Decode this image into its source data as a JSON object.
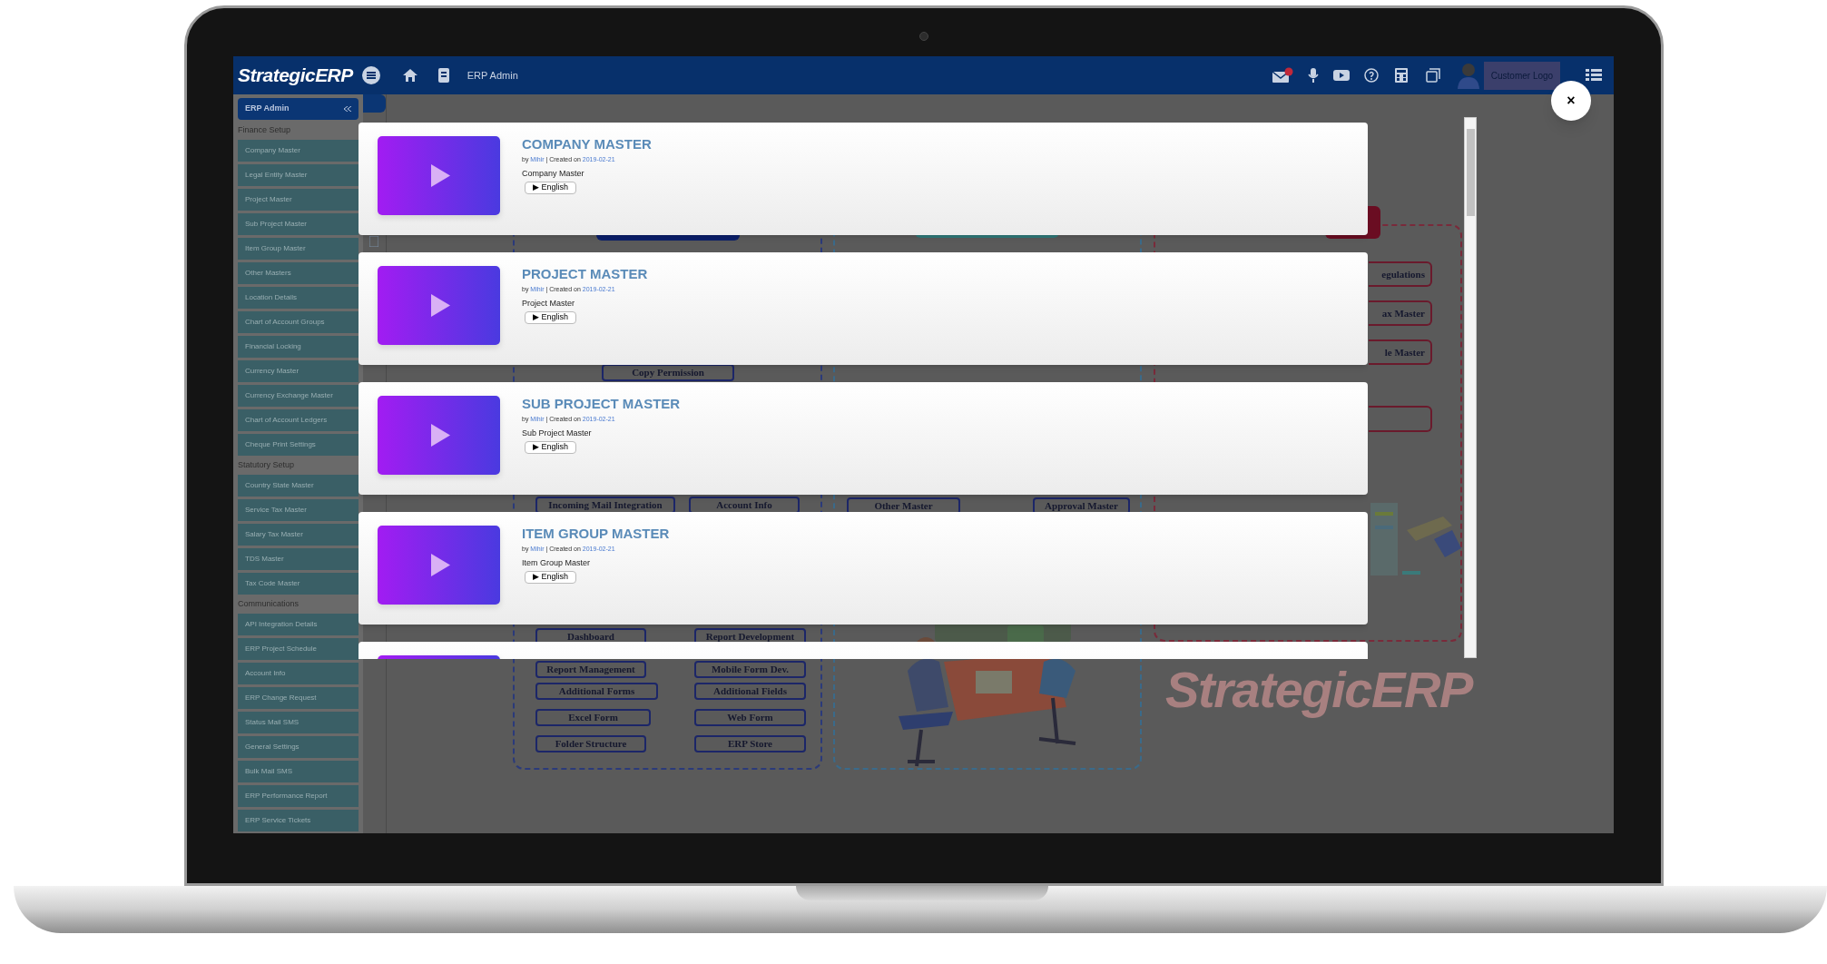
{
  "topbar": {
    "logo": "StrategicERP",
    "breadcrumb": "ERP Admin",
    "user_label": "Customer Logo"
  },
  "sidebar": {
    "header": "ERP Admin",
    "sections": [
      {
        "title": "Finance Setup",
        "items": [
          "Company Master",
          "Legal Entity Master",
          "Project Master",
          "Sub Project Master",
          "Item Group Master",
          "Other Masters",
          "Location Details",
          "Chart of Account Groups",
          "Financial Locking",
          "Currency Master",
          "Currency Exchange Master",
          "Chart of Account Ledgers",
          "Cheque Print Settings"
        ]
      },
      {
        "title": "Statutory Setup",
        "items": [
          "Country State Master",
          "Service Tax Master",
          "Salary Tax Master",
          "TDS Master",
          "Tax Code Master"
        ]
      },
      {
        "title": "Communications",
        "items": [
          "API Integration Details",
          "ERP Project Schedule",
          "Account Info",
          "ERP Change Request",
          "Status Mail SMS",
          "General Settings",
          "Bulk Mail SMS",
          "ERP Performance Report",
          "ERP Service Tickets"
        ]
      }
    ]
  },
  "diagram": {
    "left_buttons": [
      "Copy Permission",
      "Incoming Mail Integration",
      "Account Info",
      "Dashboard",
      "Report Development",
      "Report Management",
      "Mobile Form Dev.",
      "Additional Forms",
      "Additional Fields",
      "Excel Form",
      "Web Form",
      "Folder Structure",
      "ERP Store"
    ],
    "middle_buttons": [
      "Other Master",
      "Approval Master"
    ],
    "right_buttons": [
      "egulations",
      "ax Master",
      "le Master"
    ],
    "background_logo": "StrategicERP"
  },
  "videos": [
    {
      "kind": "full",
      "title": "COMPANY MASTER",
      "by": "by",
      "author": "Mihir",
      "created": "| Created on",
      "date": "2019-02-21",
      "description": "Company Master",
      "play_glyph": "▶",
      "language": "English"
    },
    {
      "kind": "full",
      "title": "PROJECT MASTER",
      "by": "by",
      "author": "Mihir",
      "created": "| Created on",
      "date": "2019-02-21",
      "description": "Project Master",
      "play_glyph": "▶",
      "language": "English"
    },
    {
      "kind": "full",
      "title": "SUB PROJECT MASTER",
      "by": "by",
      "author": "Mihir",
      "created": "| Created on",
      "date": "2019-02-21",
      "description": "Sub Project Master",
      "play_glyph": "▶",
      "language": "English"
    },
    {
      "kind": "full",
      "title": "ITEM GROUP MASTER",
      "by": "by",
      "author": "Mihir",
      "created": "| Created on",
      "date": "2019-02-21",
      "description": "Item Group Master",
      "play_glyph": "▶",
      "language": "English"
    },
    {
      "kind": "cut_off"
    }
  ],
  "close_button": "×"
}
